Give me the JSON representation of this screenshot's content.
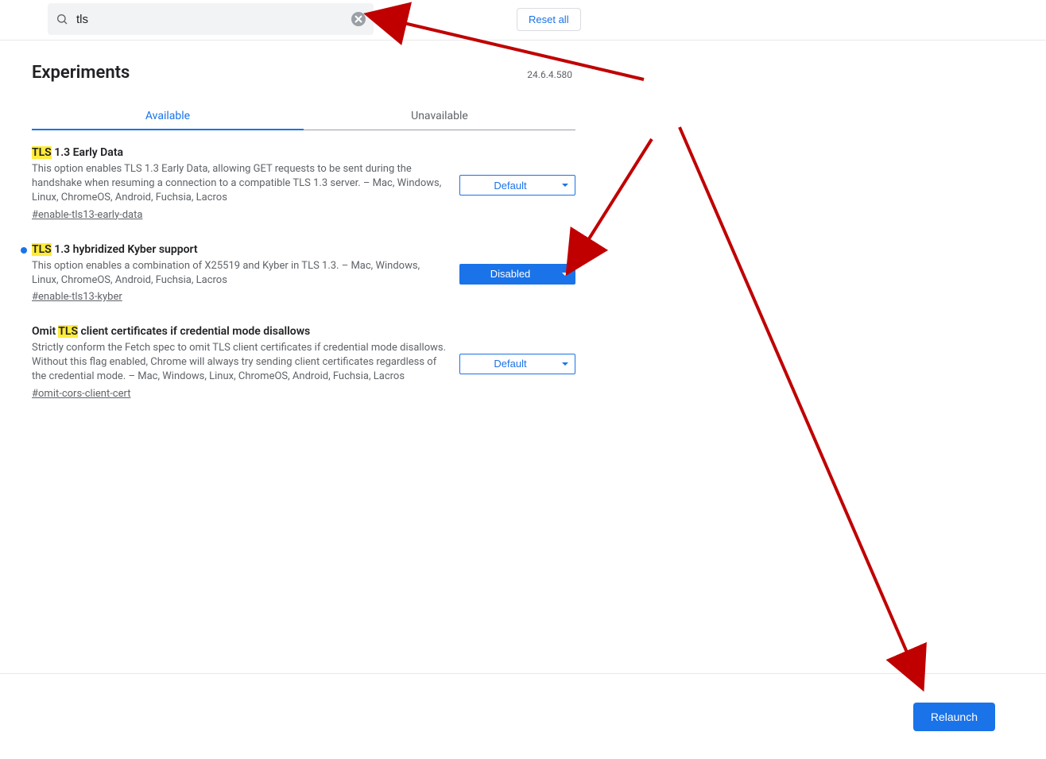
{
  "search": {
    "value": "tls"
  },
  "reset_label": "Reset all",
  "page_title": "Experiments",
  "version": "24.6.4.580",
  "tabs": {
    "available": "Available",
    "unavailable": "Unavailable"
  },
  "highlight": "TLS",
  "flags": [
    {
      "title_prefix": "TLS",
      "title_rest": " 1.3 Early Data",
      "desc": "This option enables TLS 1.3 Early Data, allowing GET requests to be sent during the handshake when resuming a connection to a compatible TLS 1.3 server. – Mac, Windows, Linux, ChromeOS, Android, Fuchsia, Lacros",
      "id": "#enable-tls13-early-data",
      "value": "Default",
      "modified": false
    },
    {
      "title_prefix": "TLS",
      "title_rest": " 1.3 hybridized Kyber support",
      "desc": "This option enables a combination of X25519 and Kyber in TLS 1.3. – Mac, Windows, Linux, ChromeOS, Android, Fuchsia, Lacros",
      "id": "#enable-tls13-kyber",
      "value": "Disabled",
      "modified": true
    },
    {
      "title_plain_pre": "Omit ",
      "title_prefix": "TLS",
      "title_rest": " client certificates if credential mode disallows",
      "desc": "Strictly conform the Fetch spec to omit TLS client certificates if credential mode disallows. Without this flag enabled, Chrome will always try sending client certificates regardless of the credential mode. – Mac, Windows, Linux, ChromeOS, Android, Fuchsia, Lacros",
      "id": "#omit-cors-client-cert",
      "value": "Default",
      "modified": false
    }
  ],
  "relaunch_label": "Relaunch"
}
